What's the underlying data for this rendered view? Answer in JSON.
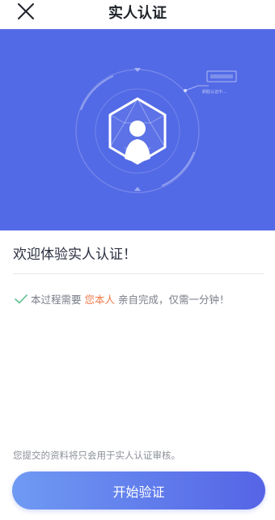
{
  "nav": {
    "title": "实人认证",
    "close_icon": "close-icon"
  },
  "hero": {
    "background_color": "#536ae6",
    "illustration_icon": "user-identity-hexagon-icon",
    "small_label": "刷脸认证中..."
  },
  "content": {
    "welcome": "欢迎体验实人认证！",
    "note_prefix": "本过程需要",
    "note_highlight": "您本人",
    "note_suffix": "亲自完成，仅需一分钟！",
    "highlight_color": "#f07a4a",
    "check_icon": "check-icon"
  },
  "footer": {
    "privacy": "您提交的资料将只会用于实人认证审核。",
    "start_button": "开始验证"
  }
}
